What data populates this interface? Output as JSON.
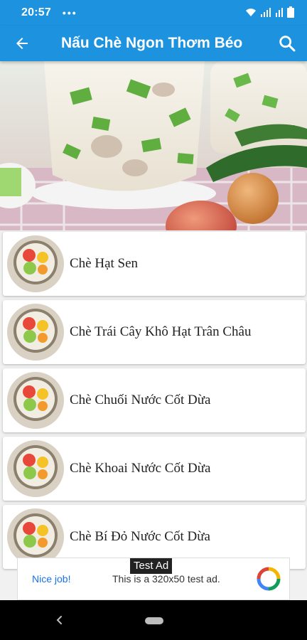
{
  "status_bar": {
    "time": "20:57",
    "overflow": "•••",
    "icons": [
      "wifi-icon",
      "signal-icon",
      "signal-icon",
      "battery-icon"
    ]
  },
  "app_bar": {
    "title": "Nấu Chè Ngon Thơm Béo",
    "back_icon": "arrow-left-icon",
    "search_icon": "search-icon",
    "background": "#1d93e0"
  },
  "hero": {
    "image": "dessert-banner-image"
  },
  "recipes": [
    {
      "label": "Chè Hạt Sen"
    },
    {
      "label": "Chè Trái Cây Khô Hạt Trân Châu"
    },
    {
      "label": "Chè Chuối Nước Cốt Dừa"
    },
    {
      "label": "Chè Khoai Nước Cốt Dừa"
    },
    {
      "label": "Chè Bí Đỏ Nước Cốt Dừa"
    }
  ],
  "ad": {
    "tag": "Test Ad",
    "headline": "Nice job!",
    "description": "This is a 320x50 test ad.",
    "logo_icon": "ad-choices-logo-icon"
  },
  "nav_bar": {
    "back_icon": "nav-back-icon",
    "home_icon": "nav-home-pill-icon"
  }
}
